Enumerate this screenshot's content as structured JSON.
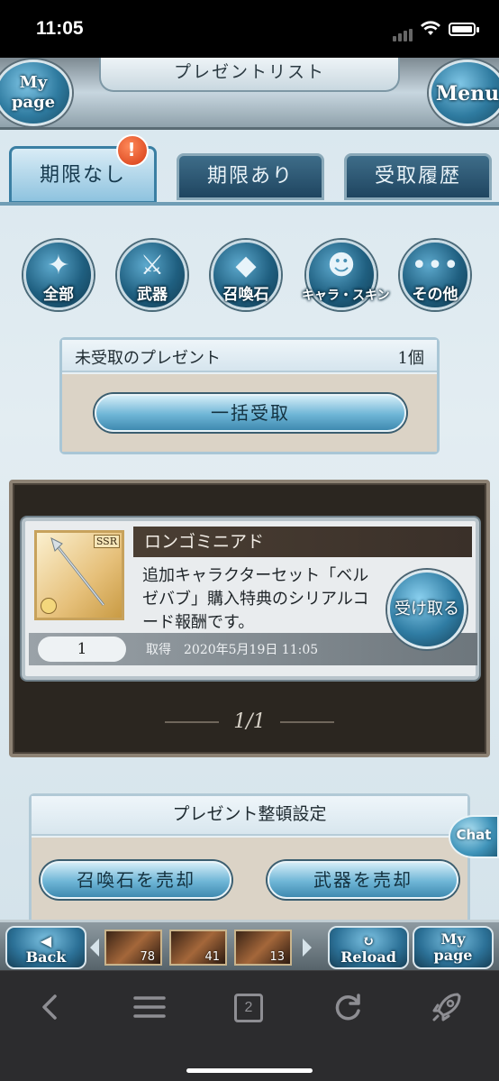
{
  "status": {
    "time": "11:05"
  },
  "header": {
    "title": "プレゼントリスト",
    "mypage_label": "My\npage",
    "menu_label": "Menu"
  },
  "tabs": [
    {
      "label": "期限なし",
      "active": true
    },
    {
      "label": "期限あり",
      "active": false
    },
    {
      "label": "受取履歴",
      "active": false
    }
  ],
  "tab_badge": "!",
  "categories": [
    {
      "label": "全部",
      "icon": "all-icon"
    },
    {
      "label": "武器",
      "icon": "sword-icon"
    },
    {
      "label": "召喚石",
      "icon": "crystal-icon"
    },
    {
      "label": "キャラ・スキン",
      "icon": "character-icon"
    },
    {
      "label": "その他",
      "icon": "more-icon"
    }
  ],
  "unclaimed": {
    "title": "未受取のプレゼント",
    "count": "1個",
    "claim_all": "一括受取"
  },
  "presents": [
    {
      "name": "ロンゴミニアド",
      "rarity": "SSR",
      "description": "追加キャラクターセット「ベルゼバブ」購入特典のシリアルコード報酬です。",
      "quantity": "1",
      "obtained_label": "取得",
      "obtained_date": "2020年5月19日 11:05",
      "receive_label": "受け取る"
    }
  ],
  "pager": "1/1",
  "sort": {
    "title": "プレゼント整頓設定",
    "sell_summon": "召喚石を売却",
    "sell_weapon": "武器を売却"
  },
  "chat_label": "Chat",
  "gamebar": {
    "back_label": "Back",
    "reload_label": "Reload",
    "mypage_label": "My\npage",
    "stacks": [
      "78",
      "41",
      "13"
    ]
  },
  "browser": {
    "tab_count": "2"
  },
  "colors": {
    "accent": "#2f7ca3",
    "frame_dark": "#2b2620",
    "badge": "#d43a14"
  }
}
